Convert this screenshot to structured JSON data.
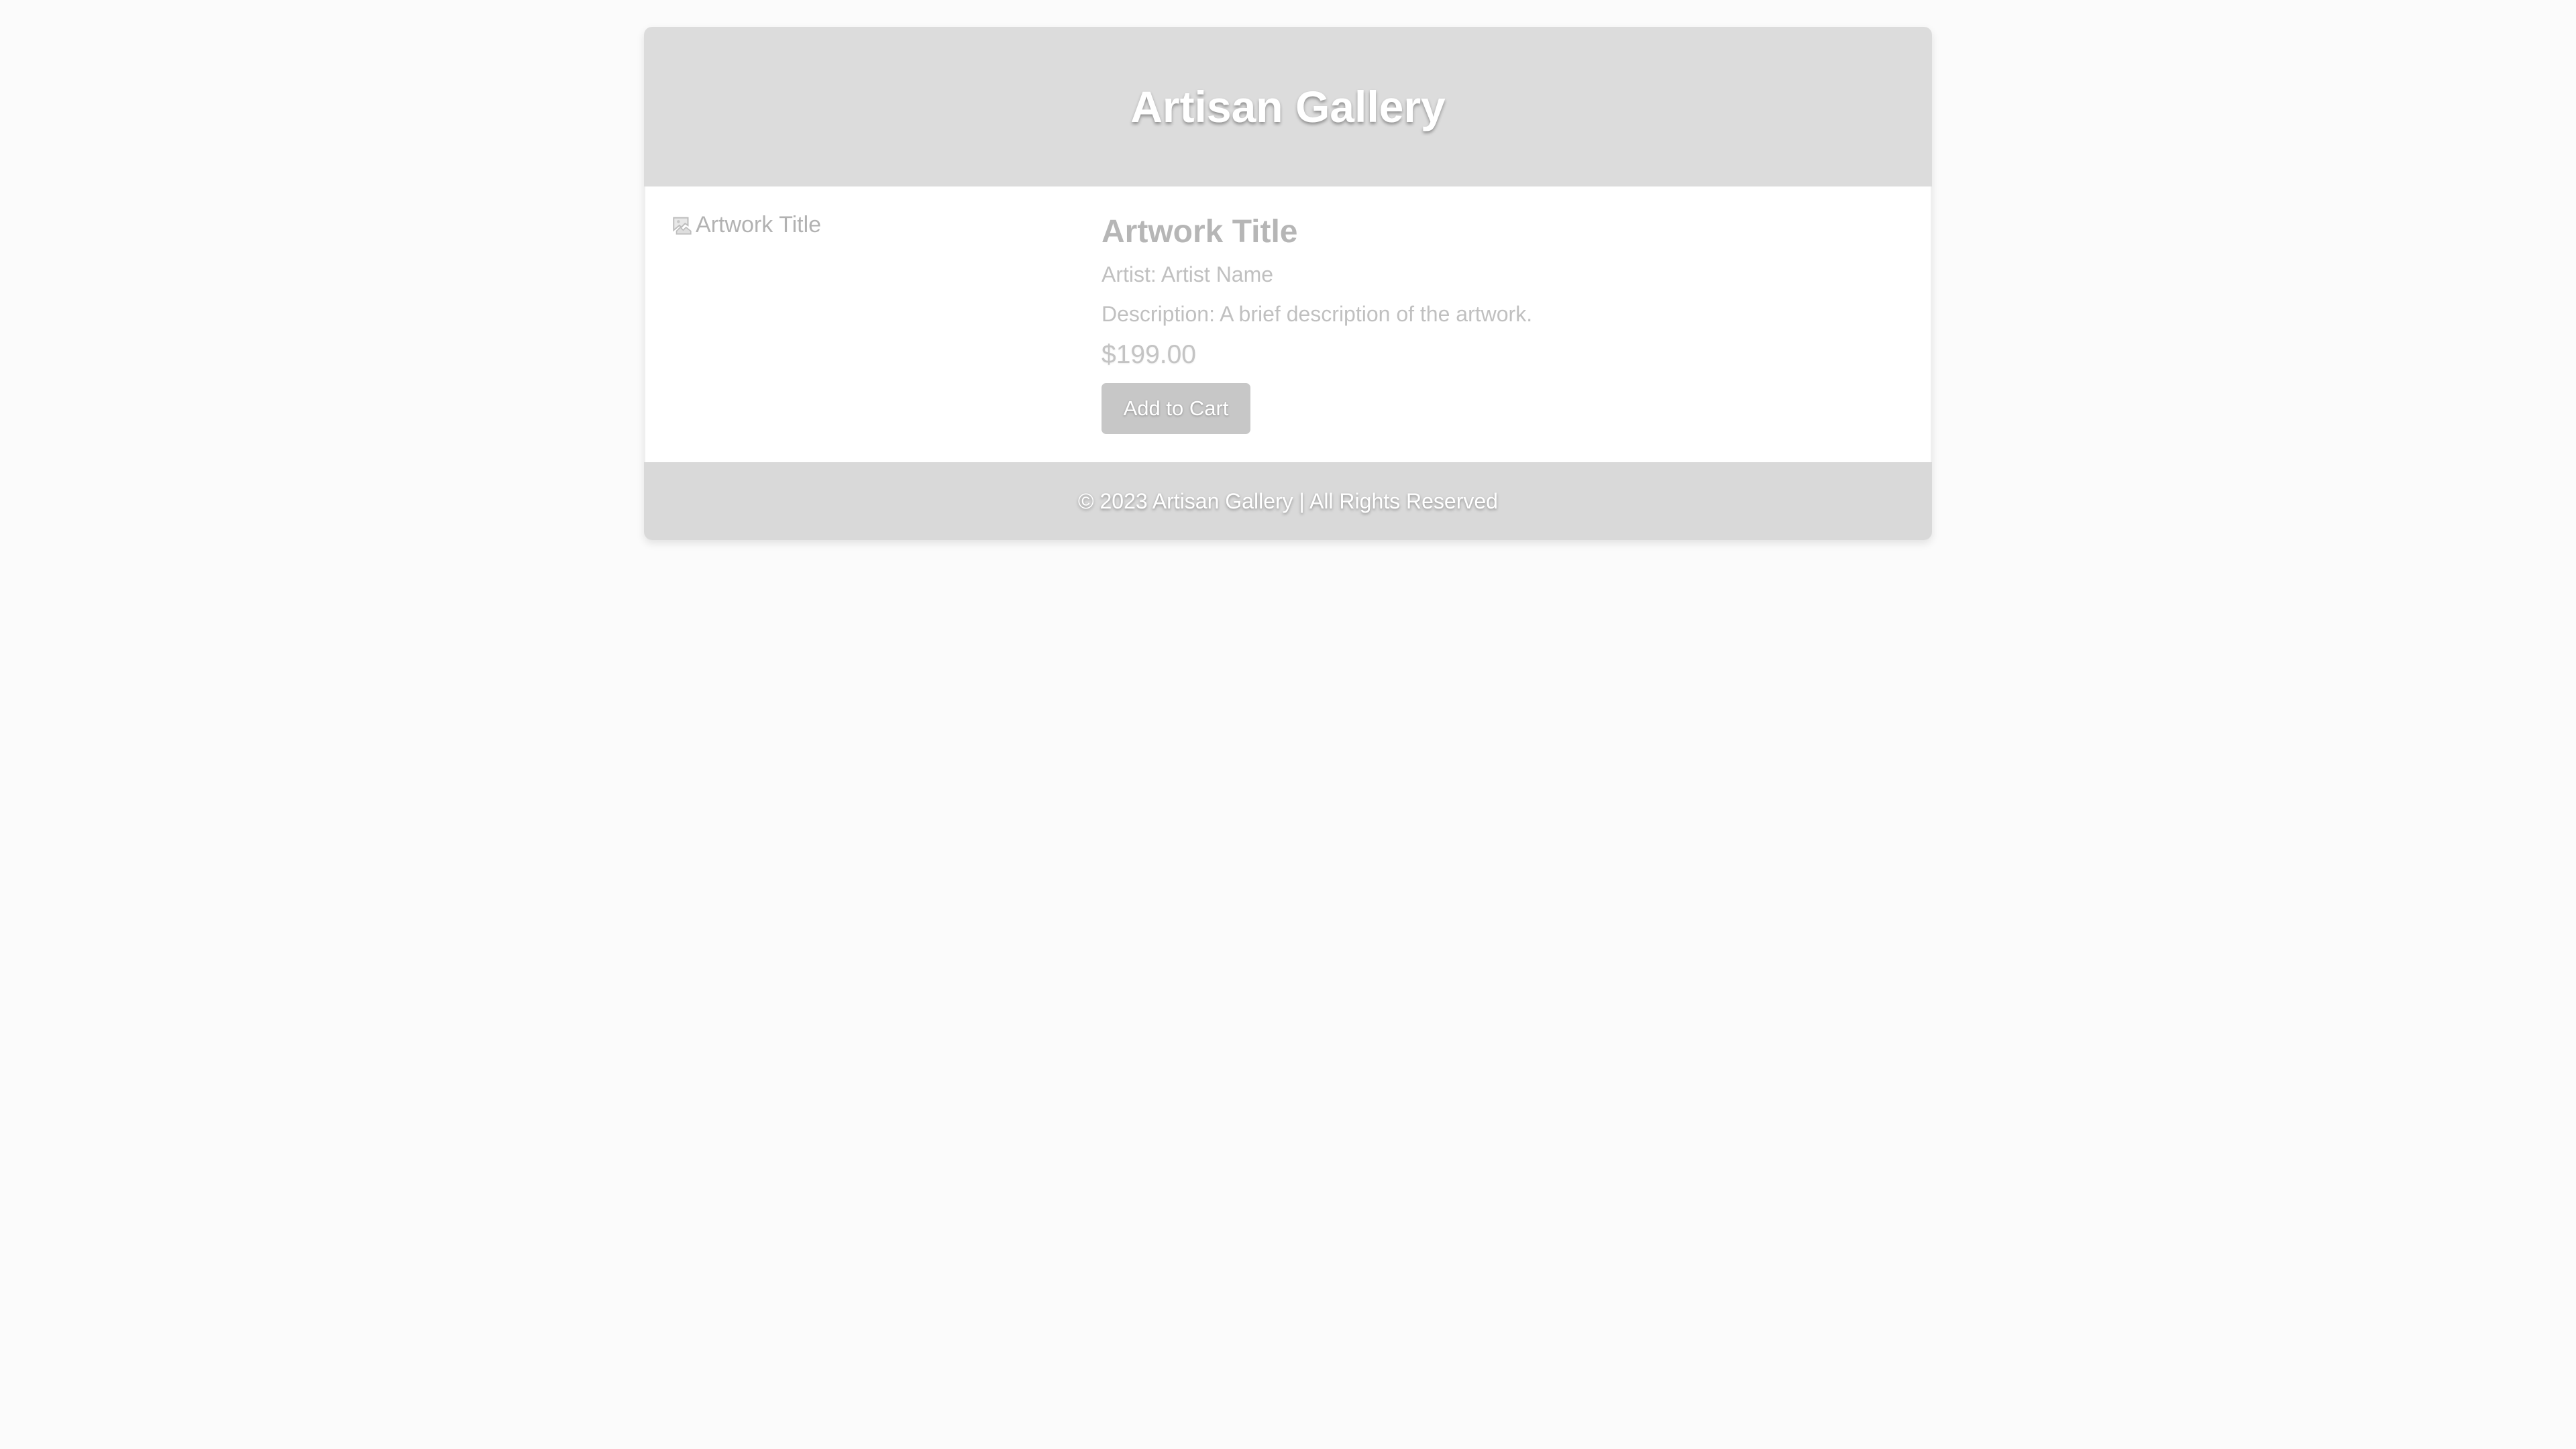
{
  "header": {
    "title": "Artisan Gallery"
  },
  "product": {
    "image_alt": "Artwork Title",
    "title": "Artwork Title",
    "artist": "Artist: Artist Name",
    "description": "Description: A brief description of the artwork.",
    "price": "$199.00",
    "add_to_cart_label": "Add to Cart",
    "image_icon": "broken-image-icon"
  },
  "footer": {
    "copyright": "© 2023 Artisan Gallery | All Rights Reserved"
  },
  "colors": {
    "page_background": "#fbfbfb",
    "header_background": "#dcdcdc",
    "footer_background": "#d9d9d9",
    "button_background": "#c7c7c7",
    "muted_text": "#c0c0c0"
  }
}
